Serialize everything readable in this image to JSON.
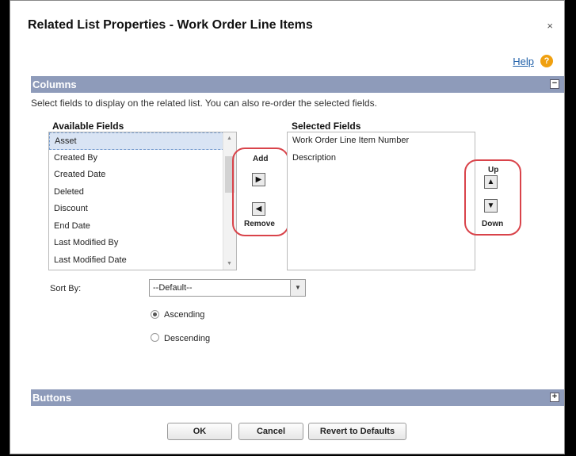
{
  "dialog": {
    "title": "Related List Properties - Work Order Line Items",
    "close_label": "×",
    "help_label": "Help",
    "help_icon_glyph": "?"
  },
  "columns_section": {
    "header": "Columns",
    "toggle_glyph": "−",
    "instruction": "Select fields to display on the related list. You can also re-order the selected fields.",
    "available_label": "Available Fields",
    "available_fields": [
      "Asset",
      "Created By",
      "Created Date",
      "Deleted",
      "Discount",
      "End Date",
      "Last Modified By",
      "Last Modified Date"
    ],
    "available_selected_index": 0,
    "selected_label": "Selected Fields",
    "selected_fields": [
      "Work Order Line Item Number",
      "Description"
    ],
    "add_label": "Add",
    "remove_label": "Remove",
    "up_label": "Up",
    "down_label": "Down",
    "icons": {
      "add": "arrow-right-icon",
      "remove": "arrow-left-icon",
      "up": "arrow-up-icon",
      "down": "arrow-down-icon"
    }
  },
  "sort": {
    "label": "Sort By:",
    "selected_value": "--Default--",
    "ascending_label": "Ascending",
    "descending_label": "Descending",
    "order": "ascending"
  },
  "buttons_section": {
    "header": "Buttons",
    "toggle_glyph": "+"
  },
  "footer": {
    "ok_label": "OK",
    "cancel_label": "Cancel",
    "revert_label": "Revert to Defaults"
  },
  "colors": {
    "section_header_bg": "#8e9bba",
    "highlight_circle": "#d9434a",
    "help_link": "#1f5fa8",
    "help_icon": "#f0a00f"
  }
}
